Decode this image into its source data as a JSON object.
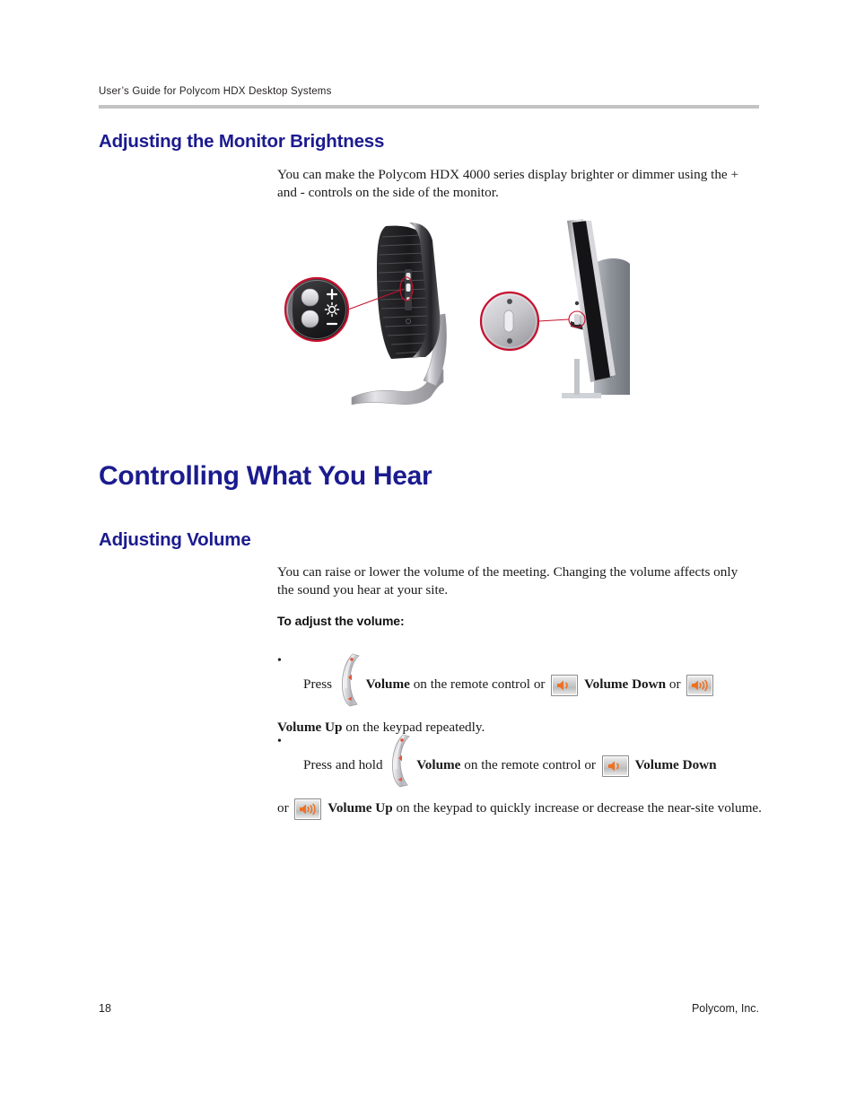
{
  "document": {
    "running_header": "User’s Guide for Polycom HDX Desktop Systems",
    "footer_page_number": "18",
    "footer_company": "Polycom, Inc."
  },
  "sections": {
    "brightness": {
      "heading": "Adjusting the Monitor Brightness",
      "paragraph": "You can make the Polycom HDX 4000 series display brighter or dimmer using the + and - controls on the side of the monitor."
    },
    "chapter": {
      "heading": "Controlling What You Hear"
    },
    "volume": {
      "heading": "Adjusting Volume",
      "paragraph": "You can raise or lower the volume of the meeting. Changing the volume affects only the sound you hear at your site.",
      "procedure_heading": "To adjust the volume:",
      "bullets": [
        {
          "marker": "•",
          "part1": "Press",
          "icon1": "remote-volume-rocker-icon",
          "bold1": "Volume",
          "part2": "on the remote control or",
          "icon2": "volume-down-keypad-icon",
          "bold2": "Volume Down",
          "part3": "or",
          "icon3": "volume-up-keypad-icon",
          "bold3": "Volume Up",
          "part4": "on the keypad repeatedly."
        },
        {
          "marker": "•",
          "part1": "Press and hold",
          "icon1": "remote-volume-rocker-icon",
          "bold1": "Volume",
          "part2": "on the remote control or",
          "icon2": "volume-down-keypad-icon",
          "bold2": "Volume Down",
          "part3": "or",
          "icon3": "volume-up-keypad-icon",
          "bold3": "Volume Up",
          "part4": "on the keypad to quickly increase or decrease the near-site volume."
        }
      ]
    }
  },
  "figure": {
    "name": "monitor-brightness-controls-illustration",
    "left_monitor": {
      "name": "hdx-4000-monitor-side-view",
      "callout": {
        "name": "brightness-controls-callout",
        "plus_label": "+",
        "minus_label": "−",
        "brightness_icon": "sun-brightness-icon"
      }
    },
    "right_monitor": {
      "name": "hdx-4000-flat-panel-side-view",
      "callout": {
        "name": "power-button-callout"
      }
    }
  },
  "colors": {
    "heading_blue": "#1b1b8f",
    "rule_gray": "#c3c3c3",
    "callout_red": "#c8102e",
    "icon_orange": "#f07020",
    "body_text": "#1a1a1a"
  }
}
